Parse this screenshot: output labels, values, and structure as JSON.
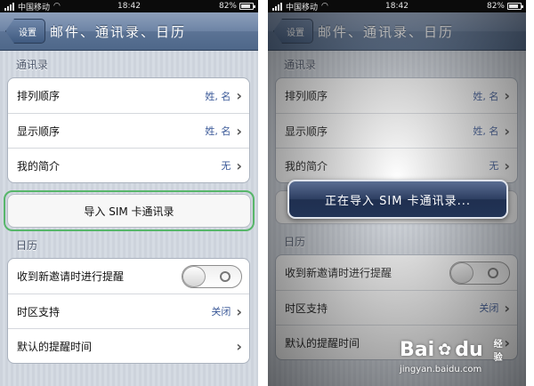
{
  "status": {
    "carrier": "中国移动",
    "time": "18:42",
    "battery": "82%",
    "battery_level": 0.82
  },
  "nav": {
    "back_label": "设置",
    "title": "邮件、通讯录、日历"
  },
  "contacts": {
    "header": "通讯录",
    "rows": [
      {
        "label": "排列顺序",
        "value": "姓, 名"
      },
      {
        "label": "显示顺序",
        "value": "姓, 名"
      },
      {
        "label": "我的简介",
        "value": "无"
      }
    ],
    "import_label": "导入 SIM 卡通讯录"
  },
  "calendar": {
    "header": "日历",
    "rows": [
      {
        "label": "收到新邀请时进行提醒",
        "toggle": false
      },
      {
        "label": "时区支持",
        "value": "关闭"
      },
      {
        "label": "默认的提醒时间",
        "value": ""
      }
    ]
  },
  "overlay": {
    "message": "正在导入 SIM 卡通讯录..."
  },
  "watermark": {
    "logo_a": "Bai",
    "logo_b": "du",
    "sub": "经验",
    "url": "jingyan.baidu.com"
  },
  "colors": {
    "nav": "#5b7395",
    "accent_green": "#57b66a",
    "value_blue": "#3b5998",
    "hud": "#223456"
  }
}
